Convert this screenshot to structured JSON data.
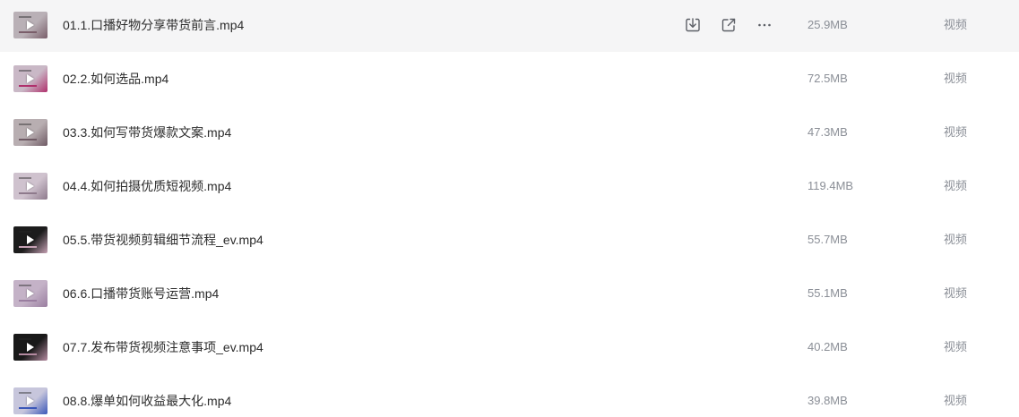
{
  "colors": {
    "hover_bg": "#f5f5f6",
    "name_text": "#2c2c2c",
    "meta_text": "#8b8f97",
    "icon": "#5c5f66"
  },
  "row_actions": [
    {
      "icon": "download-icon"
    },
    {
      "icon": "share-icon"
    },
    {
      "icon": "more-icon"
    }
  ],
  "files": [
    {
      "name": "01.1.口播好物分享带货前言.mp4",
      "size": "25.9MB",
      "type": "视频",
      "hovered": true,
      "thumb_bg": "#b9b0b6",
      "thumb_accent": "#7a5e6a"
    },
    {
      "name": "02.2.如何选品.mp4",
      "size": "72.5MB",
      "type": "视频",
      "hovered": false,
      "thumb_bg": "#c9b8c6",
      "thumb_accent": "#b0306c"
    },
    {
      "name": "03.3.如何写带货爆款文案.mp4",
      "size": "47.3MB",
      "type": "视频",
      "hovered": false,
      "thumb_bg": "#b8aeb1",
      "thumb_accent": "#6f5a64"
    },
    {
      "name": "04.4.如何拍摄优质短视频.mp4",
      "size": "119.4MB",
      "type": "视频",
      "hovered": false,
      "thumb_bg": "#cfc2ce",
      "thumb_accent": "#8e7a8c"
    },
    {
      "name": "05.5.带货视频剪辑细节流程_ev.mp4",
      "size": "55.7MB",
      "type": "视频",
      "hovered": false,
      "thumb_bg": "#1c1c1c",
      "thumb_accent": "#c6a1b4"
    },
    {
      "name": "06.6.口播带货账号运营.mp4",
      "size": "55.1MB",
      "type": "视频",
      "hovered": false,
      "thumb_bg": "#c4b2c7",
      "thumb_accent": "#9a7ea0"
    },
    {
      "name": "07.7.发布带货视频注意事项_ev.mp4",
      "size": "40.2MB",
      "type": "视频",
      "hovered": false,
      "thumb_bg": "#191919",
      "thumb_accent": "#b48aa0"
    },
    {
      "name": "08.8.爆单如何收益最大化.mp4",
      "size": "39.8MB",
      "type": "视频",
      "hovered": false,
      "thumb_bg": "#c7c6dc",
      "thumb_accent": "#3b57b8"
    }
  ]
}
